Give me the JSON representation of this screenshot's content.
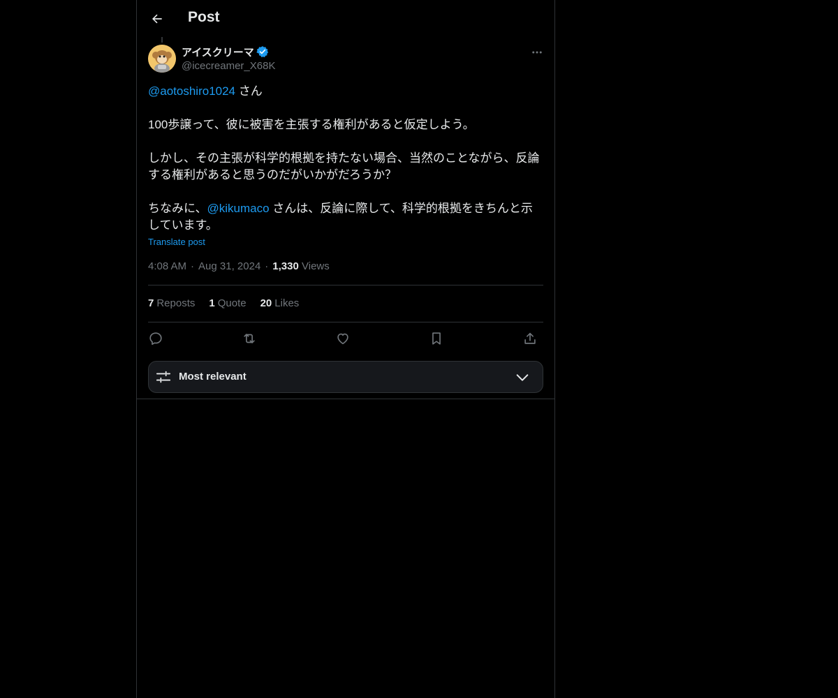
{
  "header": {
    "title": "Post",
    "back_icon": "arrow-left-icon"
  },
  "post": {
    "author": {
      "name": "アイスクリーマ",
      "handle": "@icecreamer_X68K",
      "verified": true,
      "avatar_icon": "monkey-avatar"
    },
    "body": {
      "p1": {
        "mention": "@aotoshiro1024",
        "text": " さん"
      },
      "p2": {
        "text": "100歩譲って、彼に被害を主張する権利があると仮定しよう。"
      },
      "p3": {
        "text": "しかし、その主張が科学的根拠を持たない場合、当然のことながら、反論する権利があると思うのだがいかがだろうか？"
      },
      "p4": {
        "prefix": "ちなみに、",
        "mention": "@kikumaco",
        "suffix": " さんは、反論に際して、科学的根拠をきちんと示しています。"
      }
    },
    "translate_label": "Translate post",
    "meta": {
      "time": "4:08 AM",
      "date": "Aug 31, 2024",
      "views_count": "1,330",
      "views_label": "Views",
      "separator": "·"
    },
    "stats": {
      "reposts": {
        "count": "7",
        "label": "Reposts"
      },
      "quotes": {
        "count": "1",
        "label": "Quote"
      },
      "likes": {
        "count": "20",
        "label": "Likes"
      }
    },
    "actions": [
      "reply-icon",
      "repost-icon",
      "like-icon",
      "bookmark-icon",
      "share-icon"
    ]
  },
  "sort": {
    "label": "Most relevant",
    "icon": "sliders-icon",
    "chevron": "chevron-down-icon"
  },
  "colors": {
    "background": "#000000",
    "text": "#e7e9ea",
    "secondary": "#71767b",
    "accent": "#1d9bf0",
    "border": "#2f3336"
  }
}
